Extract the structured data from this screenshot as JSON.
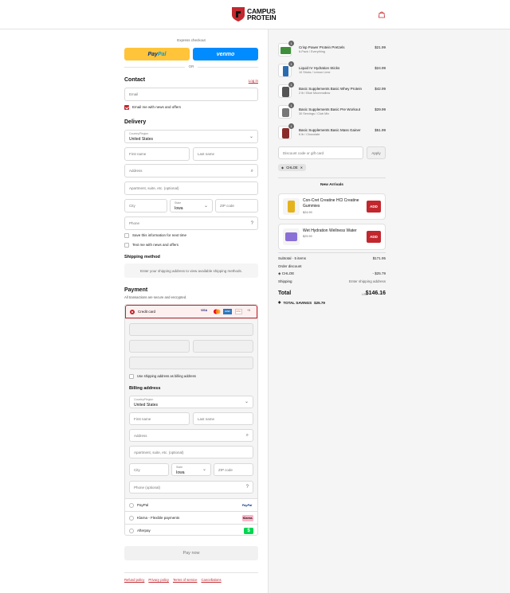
{
  "header": {
    "brand_line1": "CAMPUS",
    "brand_line2": "PROTEIN",
    "accent": "#c1272d"
  },
  "express": {
    "label": "Express checkout",
    "paypal_part1": "Pay",
    "paypal_part2": "Pal",
    "venmo": "venmo",
    "or": "OR"
  },
  "contact": {
    "title": "Contact",
    "login": "Log in",
    "email_placeholder": "Email",
    "email_news": "Email me with news and offers"
  },
  "delivery": {
    "title": "Delivery",
    "country_label": "Country/Region",
    "country_value": "United States",
    "first_name": "First name",
    "last_name": "Last name",
    "address": "Address",
    "apartment": "Apartment, suite, etc. (optional)",
    "city": "City",
    "state_label": "State",
    "state_value": "Iowa",
    "zip": "ZIP code",
    "phone": "Phone",
    "save_info": "Save this information for next time",
    "text_me": "Text me with news and offers"
  },
  "shipping": {
    "title": "Shipping method",
    "info": "Enter your shipping address to view available shipping methods."
  },
  "payment": {
    "title": "Payment",
    "subtitle": "All transactions are secure and encrypted.",
    "credit_card": "Credit card",
    "card_brands": [
      "VISA",
      "MC",
      "AMEX",
      "DISC",
      "+5"
    ],
    "use_shipping": "Use shipping address as billing address",
    "billing_title": "Billing address",
    "billing": {
      "country_label": "Country/Region",
      "country_value": "United States",
      "first_name": "First name",
      "last_name": "Last name",
      "address": "Address",
      "apartment": "Apartment, suite, etc. (optional)",
      "city": "City",
      "state_label": "State",
      "state_value": "Iowa",
      "zip": "ZIP code",
      "phone": "Phone (optional)"
    },
    "methods": [
      {
        "label": "PayPal",
        "logo": "PayPal"
      },
      {
        "label": "Klarna - Flexible payments",
        "logo": "Klarna."
      },
      {
        "label": "Afterpay",
        "logo": "$"
      }
    ],
    "pay_now": "Pay now"
  },
  "footer": {
    "links": [
      "Refund policy",
      "Privacy policy",
      "Terms of service",
      "Cancellations"
    ]
  },
  "order": {
    "items": [
      {
        "qty": "1",
        "name": "Crisp Power Protein Pretzels",
        "variant": "6-Pack / Everything",
        "price": "$21.99",
        "color": "#3f8f3a"
      },
      {
        "qty": "1",
        "name": "Liquid IV Hydration Sticks",
        "variant": "10 Sticks / Lemon Lime",
        "price": "$24.99",
        "color": "#2b6cb0"
      },
      {
        "qty": "1",
        "name": "Basic Supplements Basic Whey Protein",
        "variant": "2 lb / Blue Moonmallow",
        "price": "$42.99",
        "color": "#555555"
      },
      {
        "qty": "1",
        "name": "Basic Supplements Basic Pre Workout",
        "variant": "30 Servings / Club Mix",
        "price": "$29.99",
        "color": "#777777"
      },
      {
        "qty": "1",
        "name": "Basic Supplements Basic Mass Gainer",
        "variant": "6 lb / Chocolate",
        "price": "$51.99",
        "color": "#8a2b2b"
      }
    ],
    "discount_placeholder": "Discount code or gift card",
    "apply": "Apply",
    "code_chip": "CHLOE",
    "new_arrivals_title": "New Arrivals",
    "new_arrivals": [
      {
        "name": "Con-Cret Creatine HCl Creatine Gummies",
        "price": "$24.99",
        "add": "ADD"
      },
      {
        "name": "Wet Hydration Wellness Water",
        "price": "$29.99",
        "add": "ADD"
      }
    ],
    "subtotal_label": "Subtotal · 5 items",
    "subtotal_value": "$171.95",
    "order_discount_label": "Order discount",
    "discount_code": "CHLOE",
    "discount_value": "- $25.79",
    "shipping_label": "Shipping",
    "shipping_value": "Enter shipping address",
    "total_label": "Total",
    "total_currency": "USD",
    "total_value": "$146.16",
    "savings_label": "TOTAL SAVINGS",
    "savings_value": "$25.79"
  }
}
